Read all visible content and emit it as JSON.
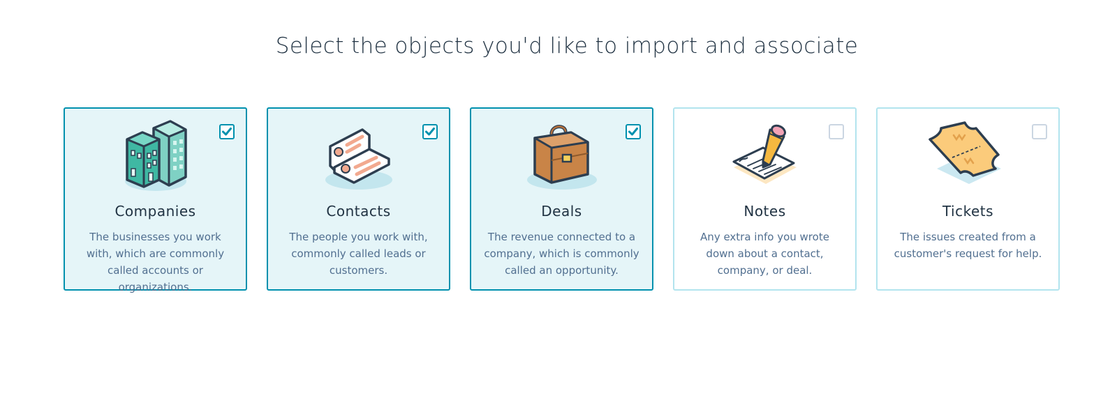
{
  "heading": "Select the objects you'd like to import and associate",
  "colors": {
    "accent": "#0091ae",
    "selected_bg": "#e5f5f8",
    "unselected_border": "#b2e4ee"
  },
  "cards": [
    {
      "title": "Companies",
      "description": "The businesses you work with, which are commonly called accounts or organizations.",
      "checked": true,
      "icon": "buildings-icon"
    },
    {
      "title": "Contacts",
      "description": "The people you work with, commonly called leads or customers.",
      "checked": true,
      "icon": "contact-cards-icon"
    },
    {
      "title": "Deals",
      "description": "The revenue connected to a company, which is commonly called an opportunity.",
      "checked": true,
      "icon": "briefcase-icon"
    },
    {
      "title": "Notes",
      "description": "Any extra info you wrote down about a contact, company, or deal.",
      "checked": false,
      "icon": "pencil-note-icon"
    },
    {
      "title": "Tickets",
      "description": "The issues created from a customer's request for help.",
      "checked": false,
      "icon": "ticket-icon"
    }
  ]
}
